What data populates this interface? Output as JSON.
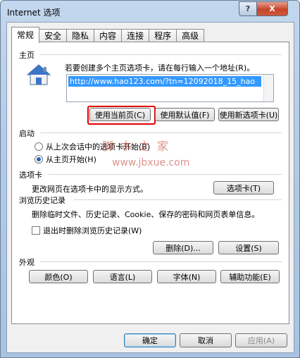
{
  "window": {
    "title": "Internet 选项",
    "help_label": "?",
    "close_label": "X"
  },
  "tabs": [
    "常规",
    "安全",
    "隐私",
    "内容",
    "连接",
    "程序",
    "高级"
  ],
  "home": {
    "section": "主页",
    "instruction": "若要创建多个主页选项卡，请在每行输入一个地址(R)。",
    "url": "http://www.hao123.com/?tn=12092018_15_hao",
    "buttons": [
      "使用当前页(C)",
      "使用默认值(F)",
      "使用新选项卡(U)"
    ]
  },
  "startup": {
    "section": "启动",
    "options": [
      "从上次会话中的选项卡开始(B)",
      "从主页开始(H)"
    ],
    "selected_index": 1
  },
  "tabs_section": {
    "section": "选项卡",
    "text": "更改网页在选项卡中的显示方式。",
    "button": "选项卡(T)"
  },
  "history": {
    "section": "浏览历史记录",
    "text": "删除临时文件、历史记录、Cookie、保存的密码和网页表单信息。",
    "checkbox": "退出时删除浏览历史记录(W)",
    "delete_button": "删除(D)...",
    "settings_button": "设置(S)"
  },
  "appearance": {
    "section": "外观",
    "buttons": [
      "颜色(O)",
      "语言(L)",
      "字体(N)",
      "辅助功能(E)"
    ]
  },
  "footer": {
    "ok": "确定",
    "cancel": "取消",
    "apply": "应用(A)"
  },
  "watermark": {
    "line1": "脚本之家",
    "line2": "www.jbxue.com"
  }
}
